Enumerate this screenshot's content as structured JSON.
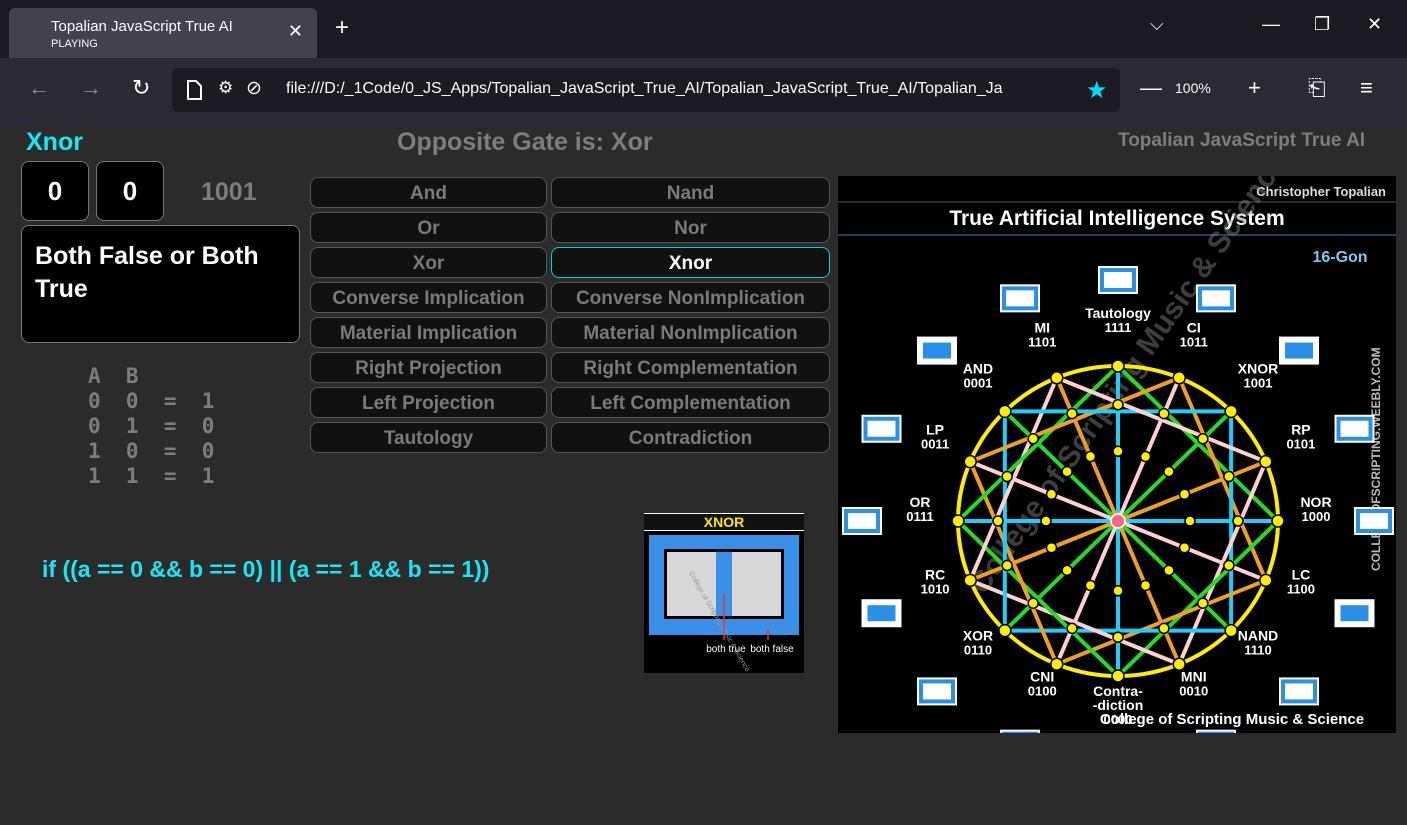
{
  "browser": {
    "tab_title": "Topalian JavaScript True AI",
    "tab_subtitle": "PLAYING",
    "url": "file:///D:/_1Code/0_JS_Apps/Topalian_JavaScript_True_AI/Topalian_JavaScript_True_AI/Topalian_Ja",
    "zoom": "100%"
  },
  "header": {
    "gate_name": "Xnor",
    "opposite": "Opposite Gate is: Xor",
    "brand": "Topalian JavaScript True AI"
  },
  "inputs": {
    "a": "0",
    "b": "0",
    "binary": "1001"
  },
  "description": "Both False or Both True",
  "truth_table": {
    "header": "A  B",
    "rows": [
      "0  0  =  1",
      "0  1  =  0",
      "1  0  =  0",
      "1  1  =  1"
    ]
  },
  "code": "if ((a == 0 && b == 0) || (a == 1 && b == 1))",
  "gates": [
    "And",
    "Nand",
    "Or",
    "Nor",
    "Xor",
    "Xnor",
    "Converse Implication",
    "Converse NonImplication",
    "Material Implication",
    "Material NonImplication",
    "Right Projection",
    "Right Complementation",
    "Left Projection",
    "Left Complementation",
    "Tautology",
    "Contradiction"
  ],
  "active_gate": "Xnor",
  "mini_diagram": {
    "title": "XNOR",
    "watermark": "College of Scripting Music & Science",
    "labels": [
      "both true",
      "both false"
    ]
  },
  "diagram": {
    "author": "Christopher Topalian",
    "title": "True Artificial Intelligence System",
    "subtitle": "16-Gon",
    "side_text": "COLLEGEOFSCRIPTING.WEEBLY.COM",
    "footer": "College of Scripting Music & Science",
    "watermark": "College of Scripting Music & Science",
    "nodes": [
      {
        "name": "Tautology",
        "code": "1111"
      },
      {
        "name": "CI",
        "code": "1011"
      },
      {
        "name": "XNOR",
        "code": "1001"
      },
      {
        "name": "RP",
        "code": "0101"
      },
      {
        "name": "NOR",
        "code": "1000"
      },
      {
        "name": "LC",
        "code": "1100"
      },
      {
        "name": "NAND",
        "code": "1110"
      },
      {
        "name": "MNI",
        "code": "0010"
      },
      {
        "name": "Contra-\n-diction",
        "code": "0000"
      },
      {
        "name": "CNI",
        "code": "0100"
      },
      {
        "name": "XOR",
        "code": "0110"
      },
      {
        "name": "RC",
        "code": "1010"
      },
      {
        "name": "OR",
        "code": "0111"
      },
      {
        "name": "LP",
        "code": "0011"
      },
      {
        "name": "AND",
        "code": "0001"
      },
      {
        "name": "MI",
        "code": "1101"
      }
    ]
  }
}
